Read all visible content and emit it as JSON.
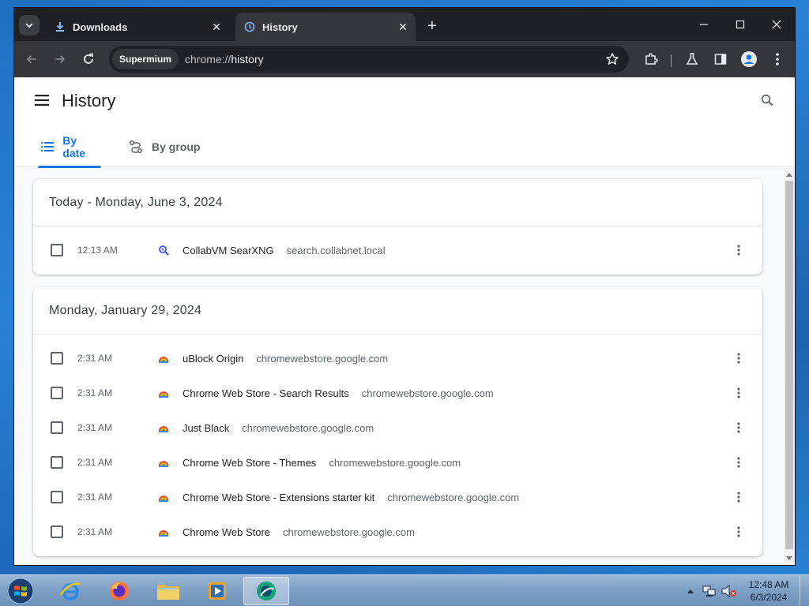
{
  "browser": {
    "tabs": [
      {
        "label": "Downloads",
        "icon": "download-icon",
        "active": false
      },
      {
        "label": "History",
        "icon": "history-clock-icon",
        "active": true
      }
    ],
    "omnibox": {
      "chip": "Supermium",
      "url_scheme": "chrome://",
      "url_path": "history"
    }
  },
  "page": {
    "title": "History",
    "tabs": [
      {
        "label": "By date",
        "selected": true
      },
      {
        "label": "By group",
        "selected": false
      }
    ],
    "groups": [
      {
        "heading": "Today - Monday, June 3, 2024",
        "entries": [
          {
            "time": "12:13 AM",
            "title": "CollabVM SearXNG",
            "domain": "search.collabnet.local",
            "favicon": "searxng-icon"
          }
        ]
      },
      {
        "heading": "Monday, January 29, 2024",
        "entries": [
          {
            "time": "2:31 AM",
            "title": "uBlock Origin",
            "domain": "chromewebstore.google.com",
            "favicon": "chrome-web-store-icon"
          },
          {
            "time": "2:31 AM",
            "title": "Chrome Web Store - Search Results",
            "domain": "chromewebstore.google.com",
            "favicon": "chrome-web-store-icon"
          },
          {
            "time": "2:31 AM",
            "title": "Just Black",
            "domain": "chromewebstore.google.com",
            "favicon": "chrome-web-store-icon"
          },
          {
            "time": "2:31 AM",
            "title": "Chrome Web Store - Themes",
            "domain": "chromewebstore.google.com",
            "favicon": "chrome-web-store-icon"
          },
          {
            "time": "2:31 AM",
            "title": "Chrome Web Store - Extensions starter kit",
            "domain": "chromewebstore.google.com",
            "favicon": "chrome-web-store-icon"
          },
          {
            "time": "2:31 AM",
            "title": "Chrome Web Store",
            "domain": "chromewebstore.google.com",
            "favicon": "chrome-web-store-icon"
          }
        ]
      }
    ]
  },
  "taskbar": {
    "apps": [
      "internet-explorer-icon",
      "firefox-icon",
      "file-explorer-icon",
      "media-player-icon",
      "supermium-icon"
    ],
    "clock_time": "12:48 AM",
    "clock_date": "6/3/2024"
  },
  "colors": {
    "accent": "#1a73e8",
    "tabstrip": "#202124",
    "toolbar": "#35363a"
  }
}
